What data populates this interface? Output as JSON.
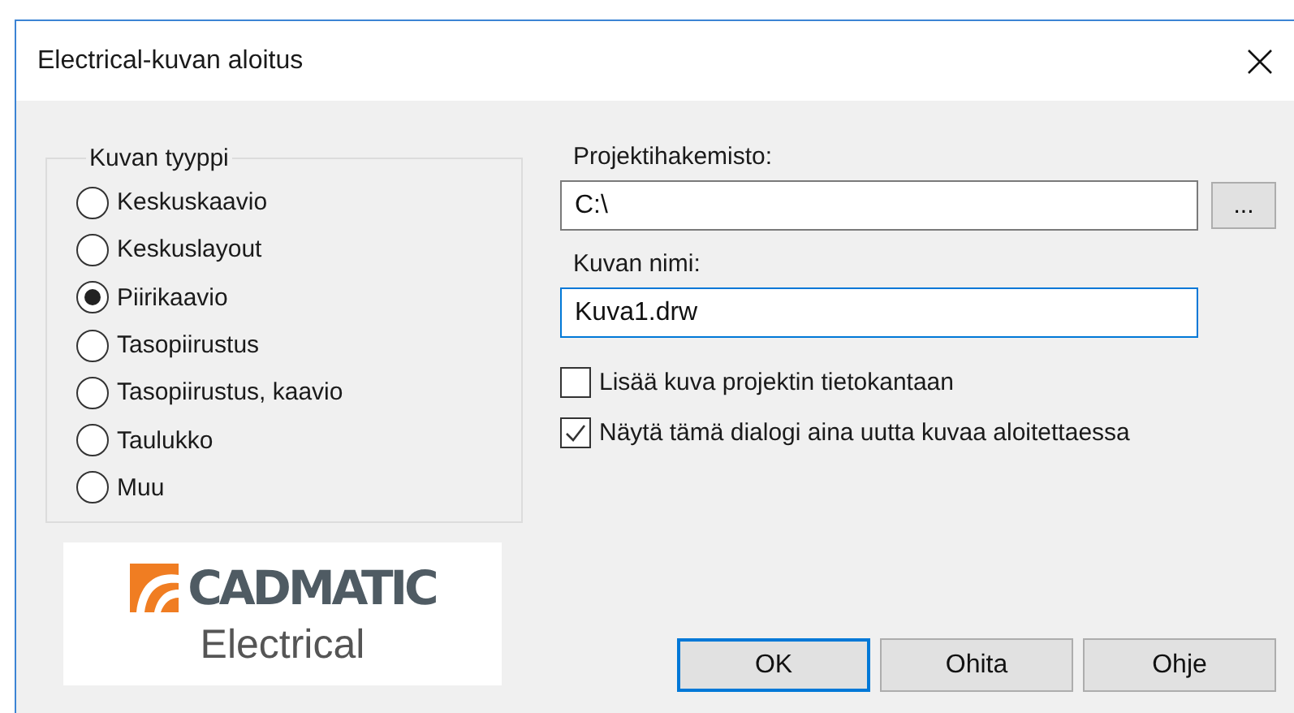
{
  "window": {
    "title": "Electrical-kuvan aloitus"
  },
  "drawing_type": {
    "label": "Kuvan tyyppi",
    "options": [
      {
        "label": "Keskuskaavio",
        "selected": false
      },
      {
        "label": "Keskuslayout",
        "selected": false
      },
      {
        "label": "Piirikaavio",
        "selected": true
      },
      {
        "label": "Tasopiirustus",
        "selected": false
      },
      {
        "label": "Tasopiirustus, kaavio",
        "selected": false
      },
      {
        "label": "Taulukko",
        "selected": false
      },
      {
        "label": "Muu",
        "selected": false
      }
    ]
  },
  "logo": {
    "brand": "CADMATIC",
    "product": "Electrical"
  },
  "project_folder": {
    "label": "Projektihakemisto:",
    "value": "C:\\",
    "browse": "...",
    "focused": false
  },
  "drawing_name": {
    "label": "Kuvan nimi:",
    "value": "Kuva1.drw",
    "focused": true
  },
  "checkboxes": [
    {
      "label": "Lisää kuva projektin tietokantaan",
      "checked": false
    },
    {
      "label": "Näytä tämä dialogi aina uutta kuvaa aloitettaessa",
      "checked": true
    }
  ],
  "buttons": [
    {
      "label": "OK",
      "default": true
    },
    {
      "label": "Ohita",
      "default": false
    },
    {
      "label": "Ohje",
      "default": false
    }
  ]
}
